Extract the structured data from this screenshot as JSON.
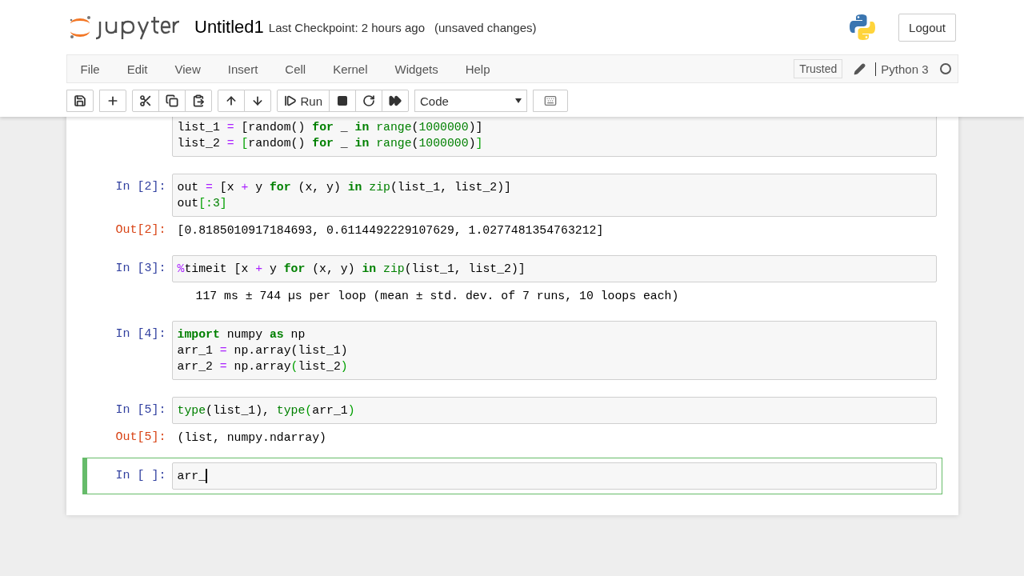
{
  "header": {
    "notebook_name": "Untitled1",
    "checkpoint": "Last Checkpoint: 2 hours ago",
    "autosave_status": "(unsaved changes)",
    "logout": "Logout"
  },
  "menubar": {
    "items": [
      "File",
      "Edit",
      "View",
      "Insert",
      "Cell",
      "Kernel",
      "Widgets",
      "Help"
    ],
    "trusted": "Trusted",
    "kernel_name": "Python 3",
    "kernel_busy": false
  },
  "toolbar": {
    "groups": [
      [
        {
          "kind": "save"
        }
      ],
      [
        {
          "kind": "insert"
        }
      ],
      [
        {
          "kind": "cut"
        },
        {
          "kind": "copy"
        },
        {
          "kind": "paste"
        }
      ],
      [
        {
          "kind": "up"
        },
        {
          "kind": "down"
        }
      ],
      [
        {
          "kind": "run",
          "label": "Run"
        },
        {
          "kind": "stop"
        },
        {
          "kind": "restart"
        },
        {
          "kind": "run-all"
        }
      ]
    ],
    "cell_type": "Code"
  },
  "cells": [
    {
      "selected": false,
      "input": [
        [
          {
            "kind": "plain",
            "text": "list_1 "
          },
          {
            "kind": "op",
            "text": "="
          },
          {
            "kind": "plain",
            "text": " [random() "
          },
          {
            "kind": "kw",
            "text": "for"
          },
          {
            "kind": "plain",
            "text": " _ "
          },
          {
            "kind": "kw",
            "text": "in"
          },
          {
            "kind": "builtin",
            "text": " range"
          },
          {
            "kind": "plain",
            "text": "("
          },
          {
            "kind": "num",
            "text": "1000000"
          },
          {
            "kind": "plain",
            "text": ")]"
          }
        ],
        [
          {
            "kind": "plain",
            "text": "list_2 "
          },
          {
            "kind": "op",
            "text": "="
          },
          {
            "kind": "match",
            "text": " ["
          },
          {
            "kind": "plain",
            "text": "random() "
          },
          {
            "kind": "kw",
            "text": "for"
          },
          {
            "kind": "plain",
            "text": " _ "
          },
          {
            "kind": "kw",
            "text": "in"
          },
          {
            "kind": "builtin",
            "text": " range"
          },
          {
            "kind": "plain",
            "text": "("
          },
          {
            "kind": "num",
            "text": "1000000"
          },
          {
            "kind": "plain",
            "text": ")"
          },
          {
            "kind": "match",
            "text": "]"
          }
        ]
      ]
    },
    {
      "prompt": "In [2]:",
      "selected": false,
      "input": [
        [
          {
            "kind": "plain",
            "text": "out "
          },
          {
            "kind": "op",
            "text": "="
          },
          {
            "kind": "plain",
            "text": " [x "
          },
          {
            "kind": "op",
            "text": "+"
          },
          {
            "kind": "plain",
            "text": " y "
          },
          {
            "kind": "kw",
            "text": "for"
          },
          {
            "kind": "plain",
            "text": " (x, y) "
          },
          {
            "kind": "kw",
            "text": "in"
          },
          {
            "kind": "builtin",
            "text": " zip"
          },
          {
            "kind": "plain",
            "text": "(list_1, list_2)]"
          }
        ],
        [
          {
            "kind": "plain",
            "text": "out"
          },
          {
            "kind": "match",
            "text": "[:"
          },
          {
            "kind": "num",
            "text": "3"
          },
          {
            "kind": "match",
            "text": "]"
          }
        ]
      ],
      "output": {
        "kind": "result",
        "prompt": "Out[2]:",
        "text": "[0.8185010917184693, 0.6114492229107629, 1.0277481354763212]"
      }
    },
    {
      "prompt": "In [3]:",
      "selected": false,
      "input": [
        [
          {
            "kind": "op",
            "text": "%"
          },
          {
            "kind": "plain",
            "text": "timeit [x "
          },
          {
            "kind": "op",
            "text": "+"
          },
          {
            "kind": "plain",
            "text": " y "
          },
          {
            "kind": "kw",
            "text": "for"
          },
          {
            "kind": "plain",
            "text": " (x, y) "
          },
          {
            "kind": "kw",
            "text": "in"
          },
          {
            "kind": "builtin",
            "text": " zip"
          },
          {
            "kind": "plain",
            "text": "(list_1, list_2)]"
          }
        ]
      ],
      "output": {
        "kind": "stream",
        "text": "117 ms ± 744 µs per loop (mean ± std. dev. of 7 runs, 10 loops each)"
      }
    },
    {
      "prompt": "In [4]:",
      "selected": false,
      "input": [
        [
          {
            "kind": "kw",
            "text": "import"
          },
          {
            "kind": "plain",
            "text": " numpy "
          },
          {
            "kind": "kw",
            "text": "as"
          },
          {
            "kind": "plain",
            "text": " np"
          }
        ],
        [
          {
            "kind": "plain",
            "text": "arr_1 "
          },
          {
            "kind": "op",
            "text": "="
          },
          {
            "kind": "plain",
            "text": " np.array(list_1)"
          }
        ],
        [
          {
            "kind": "plain",
            "text": "arr_2 "
          },
          {
            "kind": "op",
            "text": "="
          },
          {
            "kind": "plain",
            "text": " np.array"
          },
          {
            "kind": "match",
            "text": "("
          },
          {
            "kind": "plain",
            "text": "list_2"
          },
          {
            "kind": "match",
            "text": ")"
          }
        ]
      ]
    },
    {
      "prompt": "In [5]:",
      "selected": false,
      "input": [
        [
          {
            "kind": "builtin",
            "text": "type"
          },
          {
            "kind": "plain",
            "text": "(list_1), "
          },
          {
            "kind": "builtin",
            "text": "type"
          },
          {
            "kind": "match",
            "text": "("
          },
          {
            "kind": "plain",
            "text": "arr_1"
          },
          {
            "kind": "match",
            "text": ")"
          }
        ]
      ],
      "output": {
        "kind": "result",
        "prompt": "Out[5]:",
        "text": "(list, numpy.ndarray)"
      }
    },
    {
      "prompt": "In [ ]:",
      "selected": true,
      "input": [
        [
          {
            "kind": "plain",
            "text": "arr_"
          }
        ]
      ],
      "cursor": true
    }
  ]
}
